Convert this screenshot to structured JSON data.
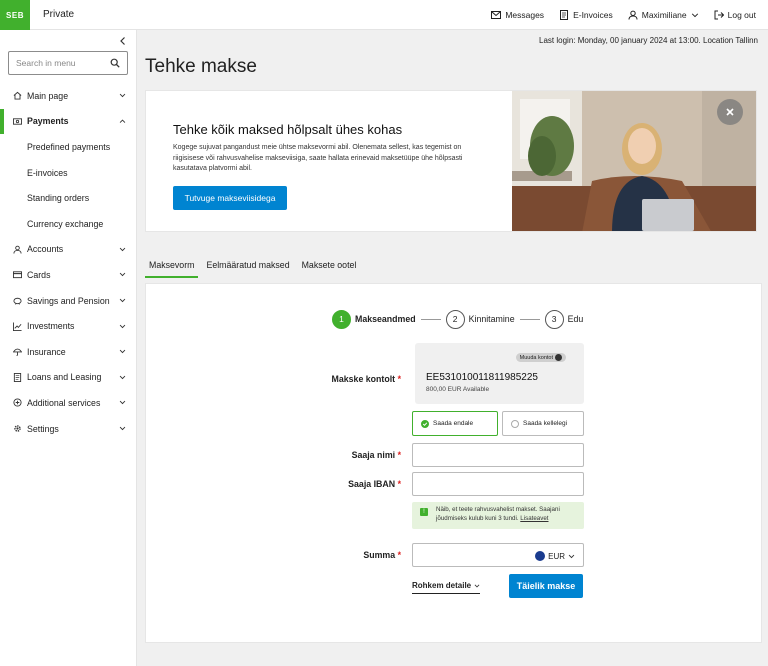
{
  "topbar": {
    "logo": "SEB",
    "brand": "Private",
    "messages": "Messages",
    "einvoices": "E-Invoices",
    "user": "Maximiliane",
    "logout": "Log out"
  },
  "sidebar": {
    "search_placeholder": "Search in menu",
    "items": [
      {
        "label": "Main page",
        "icon": "home-icon"
      },
      {
        "label": "Payments",
        "icon": "payments-icon"
      },
      {
        "label": "Predefined payments"
      },
      {
        "label": "E-invoices"
      },
      {
        "label": "Standing orders"
      },
      {
        "label": "Currency exchange"
      },
      {
        "label": "Accounts",
        "icon": "user-icon"
      },
      {
        "label": "Cards",
        "icon": "card-icon"
      },
      {
        "label": "Savings and Pension",
        "icon": "piggy-icon"
      },
      {
        "label": "Investments",
        "icon": "chart-icon"
      },
      {
        "label": "Insurance",
        "icon": "umbrella-icon"
      },
      {
        "label": "Loans and Leasing",
        "icon": "document-icon"
      },
      {
        "label": "Additional services",
        "icon": "plus-icon"
      },
      {
        "label": "Settings",
        "icon": "gear-icon"
      }
    ]
  },
  "last_login": "Last login: Monday, 00 january 2024 at 13:00. Location Tallinn",
  "page_title": "Tehke makse",
  "hero": {
    "title": "Tehke kõik maksed hõlpsalt ühes kohas",
    "text": "Kogege sujuvat pangandust meie ühtse maksevormi abil. Olenemata sellest, kas tegemist on riigisisese või rahvusvahelise makseviisiga, saate hallata erinevaid maksetüüpe ühe hõlpsasti kasutatava platvormi abil.",
    "cta": "Tutvuge makseviisidega"
  },
  "tabs": [
    "Maksevorm",
    "Eelmääratud maksed",
    "Maksete ootel"
  ],
  "steps": [
    {
      "num": "1",
      "label": "Makseandmed"
    },
    {
      "num": "2",
      "label": "Kinnitamine"
    },
    {
      "num": "3",
      "label": "Edu"
    }
  ],
  "form": {
    "account_label": "Makske kontolt",
    "change_account": "Muuda kontot",
    "account_number": "EE531010011811985225",
    "account_available": "800,00 EUR Available",
    "opt_self": "Saada endale",
    "opt_other": "Saada kellelegi",
    "recipient_label": "Saaja nimi",
    "iban_label": "Saaja IBAN",
    "note_text": "Näib, et teete rahvusvahelist makset. Saajani jõudmiseks kulub kuni 3 tundi.",
    "note_link": "Lisateavet",
    "amount_label": "Summa",
    "currency": "EUR",
    "more_details": "Rohkem detaile",
    "submit": "Täielik makse",
    "required_mark": "*"
  },
  "colors": {
    "accent": "#41b02d",
    "primary_button": "#0084d1"
  }
}
